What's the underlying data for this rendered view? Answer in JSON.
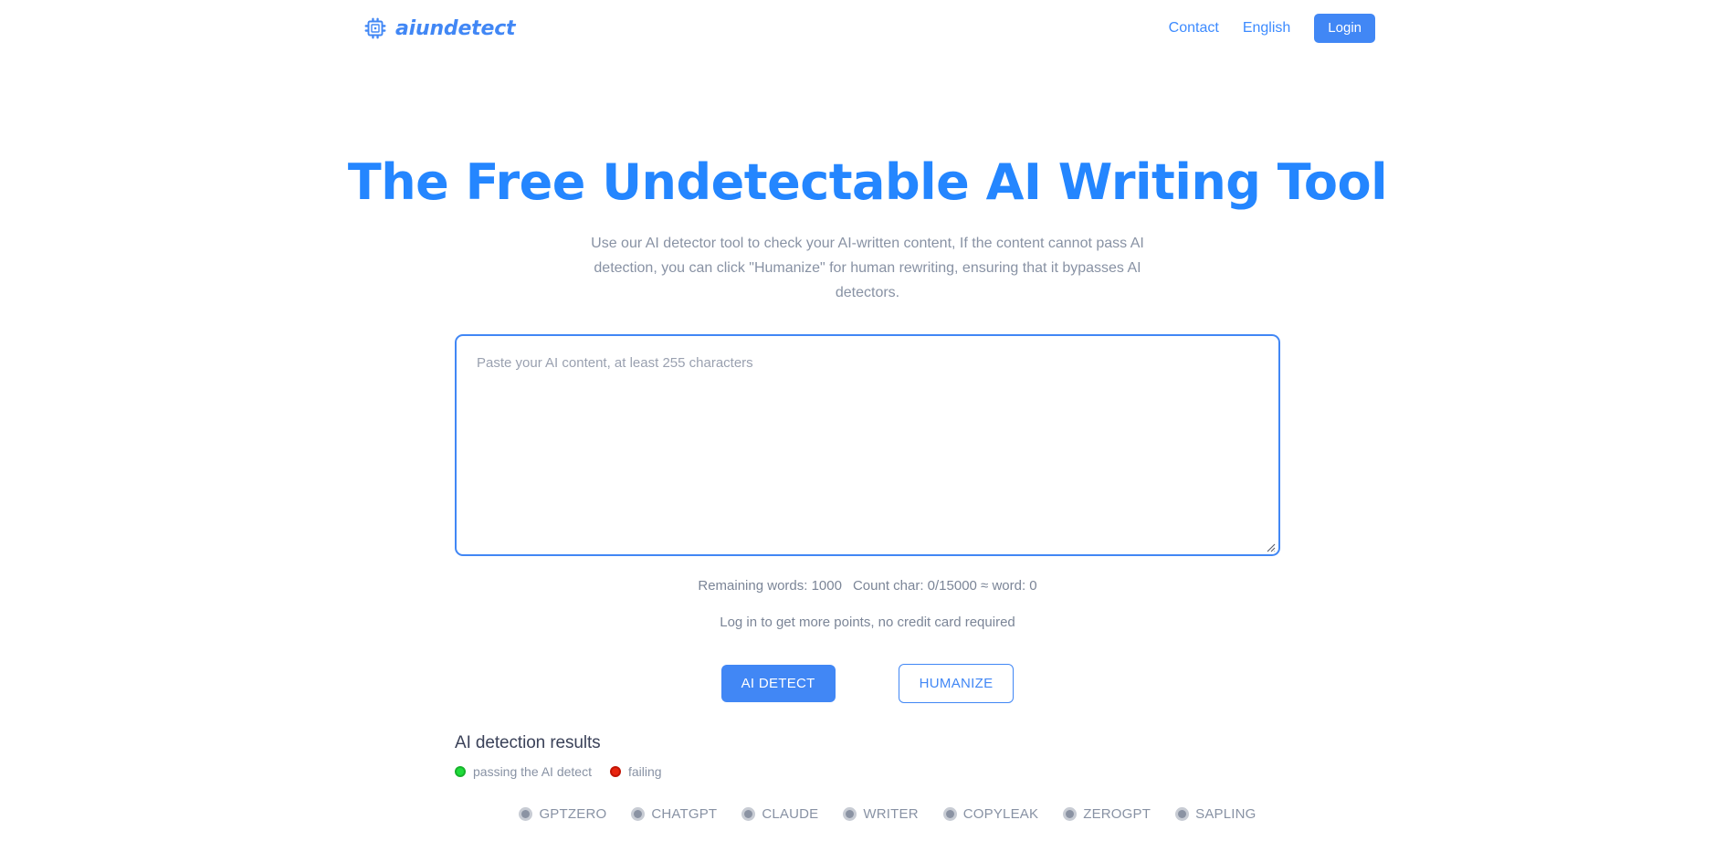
{
  "header": {
    "brand": {
      "name": "aiundetect",
      "icon": "chip-icon"
    },
    "nav": [
      {
        "label": "Contact",
        "name": "nav-link-contact"
      },
      {
        "label": "English",
        "name": "nav-link-language"
      }
    ],
    "login_label": "Login"
  },
  "hero": {
    "title": "The Free Undetectable AI Writing Tool",
    "subtitle": "Use our AI detector tool to check your AI-written content, If the content cannot pass AI detection, you can click \"Humanize\" for human rewriting, ensuring that it bypasses AI detectors."
  },
  "editor": {
    "placeholder": "Paste your AI content, at least 255 characters",
    "value": ""
  },
  "meta": {
    "remaining_words": "Remaining words: 1000",
    "char_count": "Count char: 0/15000 ≈ word: 0",
    "hint": "Log in to get more points, no credit card required"
  },
  "actions": {
    "detect_label": "AI DETECT",
    "humanize_label": "HUMANIZE"
  },
  "results": {
    "title": "AI detection results",
    "legend": [
      {
        "label": "passing the AI detect",
        "color": "#1fdc3b",
        "name": "legend-passing"
      },
      {
        "label": "failing",
        "color": "#e8240f",
        "name": "legend-failing"
      }
    ],
    "detectors": [
      {
        "label": "GPTZERO"
      },
      {
        "label": "CHATGPT"
      },
      {
        "label": "CLAUDE"
      },
      {
        "label": "WRITER"
      },
      {
        "label": "COPYLEAK"
      },
      {
        "label": "ZEROGPT"
      },
      {
        "label": "SAPLING"
      }
    ]
  },
  "colors": {
    "accent": "#4187f5",
    "title": "#2486ff",
    "muted": "#8892a4"
  }
}
